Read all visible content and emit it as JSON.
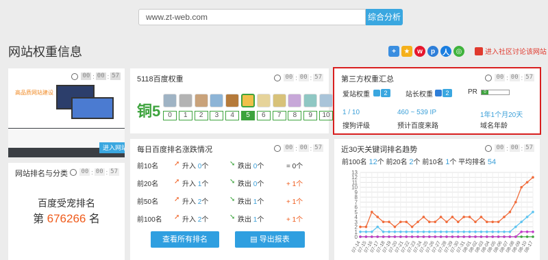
{
  "search": {
    "value": "www.zt-web.com",
    "button": "综合分析"
  },
  "page_title": "网站权重信息",
  "social": {
    "icons": [
      "add-icon",
      "star-icon",
      "weibo-icon",
      "baidu-icon",
      "renren-icon",
      "wechat-icon"
    ],
    "community_link": "进入社区讨论该网站"
  },
  "timer": {
    "d1": "00",
    "d2": "00",
    "d3": "57"
  },
  "screenshot": {
    "enter_label": "进入网站",
    "caption": "高品质网站建设"
  },
  "baidu_weight": {
    "title": "5118百度权重",
    "level_label": "铜5",
    "scale": [
      "0",
      "1",
      "2",
      "3",
      "4",
      "5",
      "6",
      "7",
      "8",
      "9",
      "10"
    ],
    "active_index": 5
  },
  "third_party": {
    "title": "第三方权重汇总",
    "aizhan_label": "爱站权重",
    "aizhan_value": "2",
    "zhanzhang_label": "站长权重",
    "zhanzhang_value": "2",
    "pr_label": "PR",
    "pr_value": "0",
    "sogou_value": "1 / 10",
    "sogou_label": "搜狗评级",
    "traffic_value": "460 ~ 539 IP",
    "traffic_label": "预计百度来路",
    "age_value": "1年1个月20天",
    "age_label": "域名年龄"
  },
  "site_rank": {
    "title": "网站排名与分类",
    "heading": "百度受宠排名",
    "prefix": "第",
    "value": "676266",
    "suffix": "名"
  },
  "daily": {
    "title": "每日百度排名涨跌情况",
    "rows": [
      {
        "label": "前10名",
        "up": "升入",
        "up_n": "0",
        "down": "跌出",
        "down_n": "0",
        "eq": "=",
        "eq_n": "0",
        "unit": "个"
      },
      {
        "label": "前20名",
        "up": "升入",
        "up_n": "1",
        "down": "跌出",
        "down_n": "0",
        "eq": "+",
        "eq_n": "1",
        "unit": "个"
      },
      {
        "label": "前50名",
        "up": "升入",
        "up_n": "2",
        "down": "跌出",
        "down_n": "1",
        "eq": "+",
        "eq_n": "1",
        "unit": "个"
      },
      {
        "label": "前100名",
        "up": "升入",
        "up_n": "2",
        "down": "跌出",
        "down_n": "1",
        "eq": "+",
        "eq_n": "1",
        "unit": "个"
      }
    ],
    "btn_all": "查看所有排名",
    "btn_export": "导出报表"
  },
  "trend": {
    "title": "近30天关键词排名趋势",
    "top100_label": "前100名",
    "top100": "12",
    "top20_label": "前20名",
    "top20": "2",
    "top10_label": "前10名",
    "top10": "1",
    "avg_label": "平均排名",
    "avg": "54",
    "unit": "个"
  },
  "chart_data": {
    "type": "line",
    "x": [
      "07-14",
      "07-15",
      "07-16",
      "07-17",
      "07-18",
      "07-19",
      "07-20",
      "07-21",
      "07-22",
      "07-23",
      "07-24",
      "07-25",
      "07-26",
      "07-27",
      "07-28",
      "07-29",
      "07-30",
      "07-31",
      "08-01",
      "08-02",
      "08-03",
      "08-04",
      "08-05",
      "08-06",
      "08-07",
      "08-08",
      "08-09",
      "08-10",
      "08-11",
      "08-12",
      "08-17"
    ],
    "xlabels": [
      "07-14",
      "07-15",
      "07-16",
      "07-17",
      "07-18",
      "07-19",
      "07-20",
      "07-21",
      "07-22",
      "07-23",
      "07-24",
      "07-25",
      "07-26",
      "07-27",
      "07-28",
      "07-29",
      "07-30",
      "07-31",
      "08-01",
      "08-02",
      "08-03",
      "08-04",
      "08-05",
      "08-06",
      "08-07",
      "08-08",
      "08-09",
      "08-10",
      "08-17"
    ],
    "yticks": [
      "0",
      "1",
      "2",
      "3",
      "4",
      "5",
      "6",
      "7",
      "8",
      "9",
      "10",
      "11",
      "12",
      "13"
    ],
    "ylim": [
      0,
      13
    ],
    "series": [
      {
        "color": "#f06b3a",
        "values": [
          2,
          2,
          5,
          4,
          3,
          3,
          2,
          3,
          3,
          2,
          3,
          4,
          3,
          3,
          4,
          3,
          4,
          3,
          4,
          4,
          3,
          4,
          3,
          3,
          3,
          4,
          5,
          7,
          10,
          11,
          12
        ]
      },
      {
        "color": "#5ec4f0",
        "values": [
          1,
          1,
          1,
          2,
          1,
          1,
          1,
          1,
          1,
          1,
          1,
          1,
          1,
          1,
          1,
          1,
          1,
          1,
          1,
          1,
          1,
          1,
          1,
          1,
          1,
          1,
          1,
          2,
          3,
          4,
          5
        ]
      },
      {
        "color": "#c23ac9",
        "values": [
          0,
          0,
          0,
          0,
          0,
          0,
          0,
          0,
          0,
          0,
          0,
          0,
          0,
          0,
          0,
          0,
          0,
          0,
          0,
          0,
          0,
          0,
          0,
          0,
          0,
          0,
          0,
          0,
          1,
          1,
          1
        ]
      },
      {
        "color": "#3da33d",
        "values": [
          0,
          0,
          0,
          0,
          0,
          0,
          0,
          0,
          0,
          0,
          0,
          0,
          0,
          0,
          0,
          0,
          0,
          0,
          0,
          0,
          0,
          0,
          0,
          0,
          0,
          0,
          0,
          0,
          0,
          0,
          0
        ]
      }
    ],
    "grid": true
  }
}
